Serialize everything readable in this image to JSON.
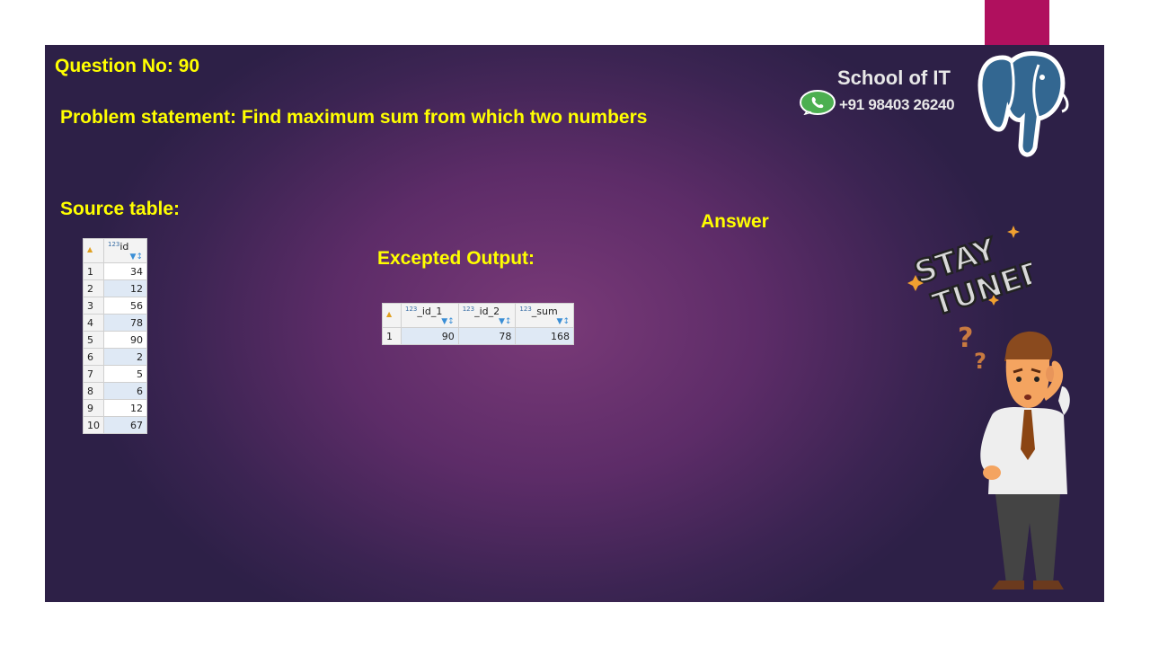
{
  "slide": {
    "question": "Question No: 90",
    "problem": "Problem statement:  Find maximum sum from which two numbers",
    "source_label": "Source table:",
    "expected_label": "Excepted Output:",
    "answer_label": "Answer"
  },
  "branding": {
    "school": "School of IT",
    "phone": "+91 98403 26240",
    "whatsapp_icon": "whatsapp-icon",
    "logo_icon": "postgresql-elephant-icon"
  },
  "stay_tuned": {
    "line1": "STAY",
    "line2": "TUNED"
  },
  "source_table": {
    "type_badge": "123",
    "column": "id",
    "rows": [
      {
        "n": "1",
        "id": "34"
      },
      {
        "n": "2",
        "id": "12"
      },
      {
        "n": "3",
        "id": "56"
      },
      {
        "n": "4",
        "id": "78"
      },
      {
        "n": "5",
        "id": "90"
      },
      {
        "n": "6",
        "id": "2"
      },
      {
        "n": "7",
        "id": "5"
      },
      {
        "n": "8",
        "id": "6"
      },
      {
        "n": "9",
        "id": "12"
      },
      {
        "n": "10",
        "id": "67"
      }
    ]
  },
  "output_table": {
    "type_badge": "123",
    "columns": [
      "_id_1",
      "_id_2",
      "_sum"
    ],
    "row": {
      "n": "1",
      "id_1": "90",
      "id_2": "78",
      "sum": "168"
    }
  },
  "colors": {
    "accent": "#b0105e",
    "heading_yellow": "#ffff00",
    "slide_bg": "#5d2c68"
  }
}
